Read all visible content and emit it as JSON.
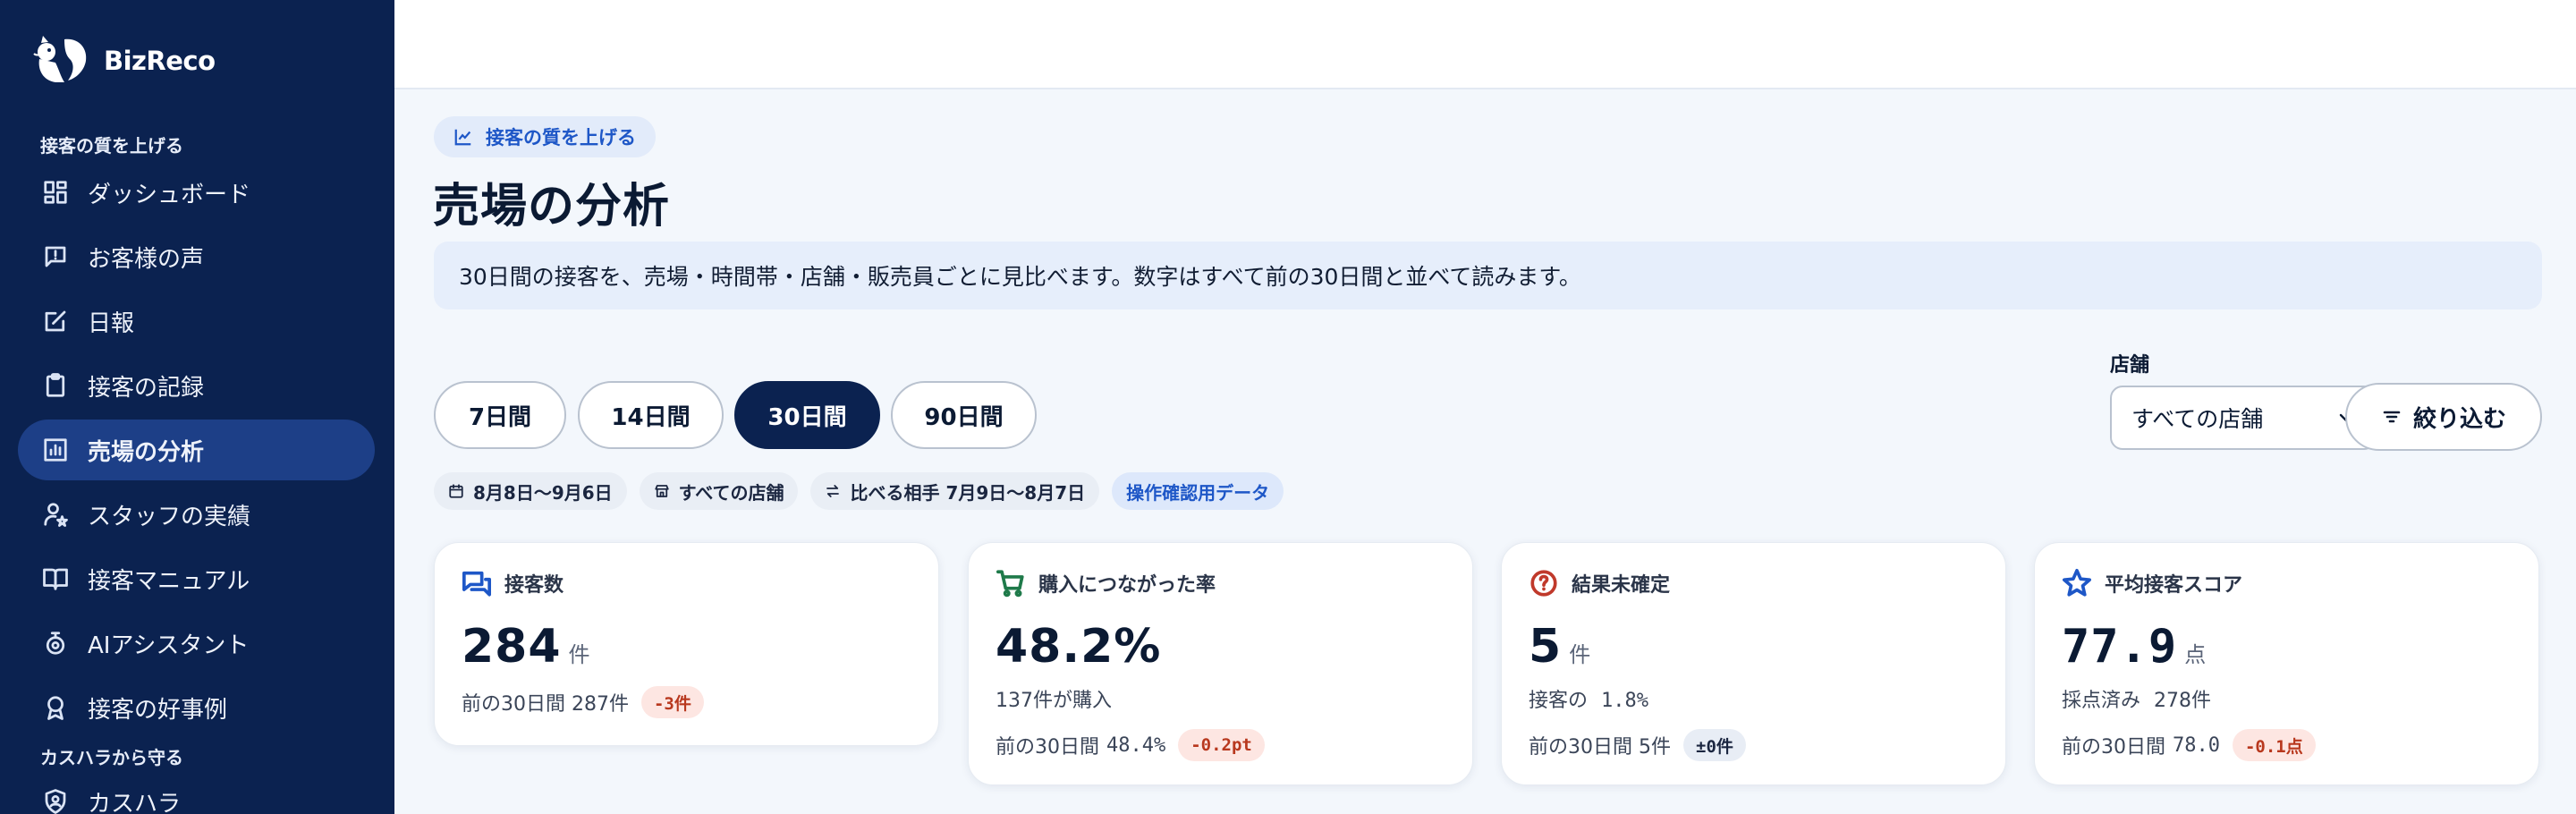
{
  "app": {
    "logo_text": "BizReco"
  },
  "sidebar": {
    "section1": "接客の質を上げる",
    "section2": "カスハラから守る",
    "items": [
      {
        "label": "ダッシュボード",
        "icon": "dashboard-icon"
      },
      {
        "label": "お客様の声",
        "icon": "feedback-icon"
      },
      {
        "label": "日報",
        "icon": "edit-icon"
      },
      {
        "label": "接客の記録",
        "icon": "clipboard-icon"
      },
      {
        "label": "売場の分析",
        "icon": "bar-chart-icon",
        "active": true
      },
      {
        "label": "スタッフの実績",
        "icon": "user-star-icon"
      },
      {
        "label": "接客マニュアル",
        "icon": "book-icon"
      },
      {
        "label": "AIアシスタント",
        "icon": "ai-icon"
      },
      {
        "label": "接客の好事例",
        "icon": "award-icon"
      },
      {
        "label": "カスハラ",
        "icon": "shield-icon"
      }
    ]
  },
  "main": {
    "breadcrumb_chip": "接客の質を上げる",
    "title": "売場の分析",
    "info": "30日間の接客を、売場・時間帯・店舗・販売員ごとに見比べます。数字はすべて前の30日間と並べて読みます。",
    "ranges": [
      "7日間",
      "14日間",
      "30日間",
      "90日間"
    ],
    "active_range": "30日間",
    "store_label": "店舗",
    "store_value": "すべての店舗",
    "filter_label": "絞り込む",
    "meta": {
      "period": "8月8日〜9月6日",
      "store": "すべての店舗",
      "compare": "比べる相手 7月9日〜8月7日",
      "badge": "操作確認用データ"
    }
  },
  "cards": [
    {
      "title": "接客数",
      "value": "284",
      "unit": "件",
      "sub": "",
      "prev": "前の30日間 287件",
      "delta": "-3件",
      "delta_type": "neg"
    },
    {
      "title": "購入につながった率",
      "value": "48.2%",
      "unit": "",
      "sub": "137件が購入",
      "prev_label": "前の30日間",
      "prev_value": "48.4%",
      "delta": "-0.2pt",
      "delta_type": "neg"
    },
    {
      "title": "結果未確定",
      "value": "5",
      "unit": "件",
      "sub_label": "接客の",
      "sub_value": "1.8%",
      "prev": "前の30日間 5件",
      "delta": "±0件",
      "delta_type": "neu"
    },
    {
      "title": "平均接客スコア",
      "value": "77.9",
      "unit": "点",
      "sub_label": "採点済み",
      "sub_value": "278件",
      "prev_label": "前の30日間",
      "prev_value": "78.0",
      "delta": "-0.1点",
      "delta_type": "neg"
    }
  ],
  "colors": {
    "sidebar_bg": "#0b2250",
    "accent": "#1e57c7",
    "negative": "#b8381e"
  }
}
